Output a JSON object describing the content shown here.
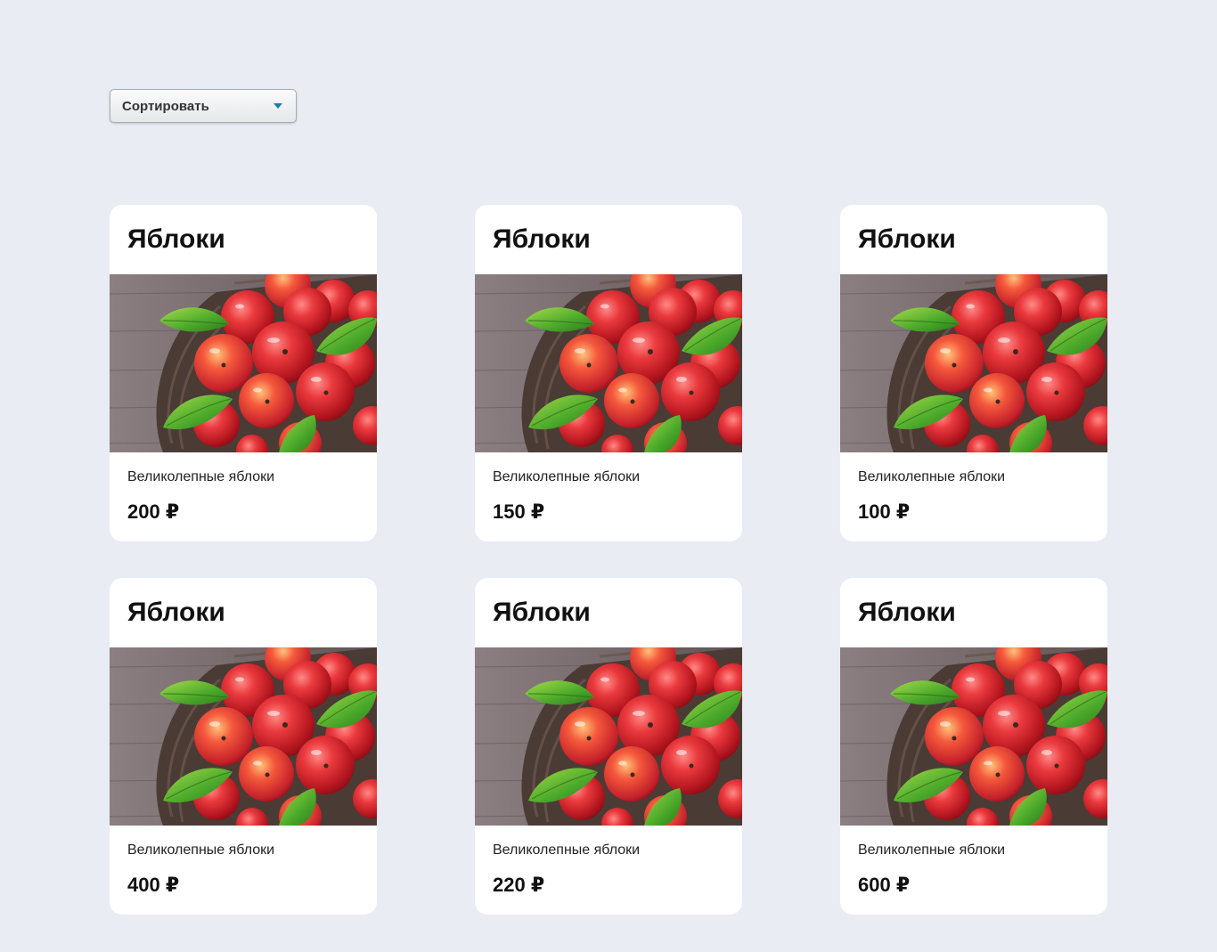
{
  "sort": {
    "label": "Сортировать",
    "accent_color": "#1a7fa3"
  },
  "products": [
    {
      "title": "Яблоки",
      "description": "Великолепные яблоки",
      "price": "200 ₽",
      "image_icon": "apples-basket-image"
    },
    {
      "title": "Яблоки",
      "description": "Великолепные яблоки",
      "price": "150 ₽",
      "image_icon": "apples-basket-image"
    },
    {
      "title": "Яблоки",
      "description": "Великолепные яблоки",
      "price": "100 ₽",
      "image_icon": "apples-basket-image"
    },
    {
      "title": "Яблоки",
      "description": "Великолепные яблоки",
      "price": "400 ₽",
      "image_icon": "apples-basket-image"
    },
    {
      "title": "Яблоки",
      "description": "Великолепные яблоки",
      "price": "220 ₽",
      "image_icon": "apples-basket-image"
    },
    {
      "title": "Яблоки",
      "description": "Великолепные яблоки",
      "price": "600 ₽",
      "image_icon": "apples-basket-image"
    }
  ],
  "colors": {
    "page_background": "#e9ecf3",
    "card_background": "#ffffff"
  }
}
